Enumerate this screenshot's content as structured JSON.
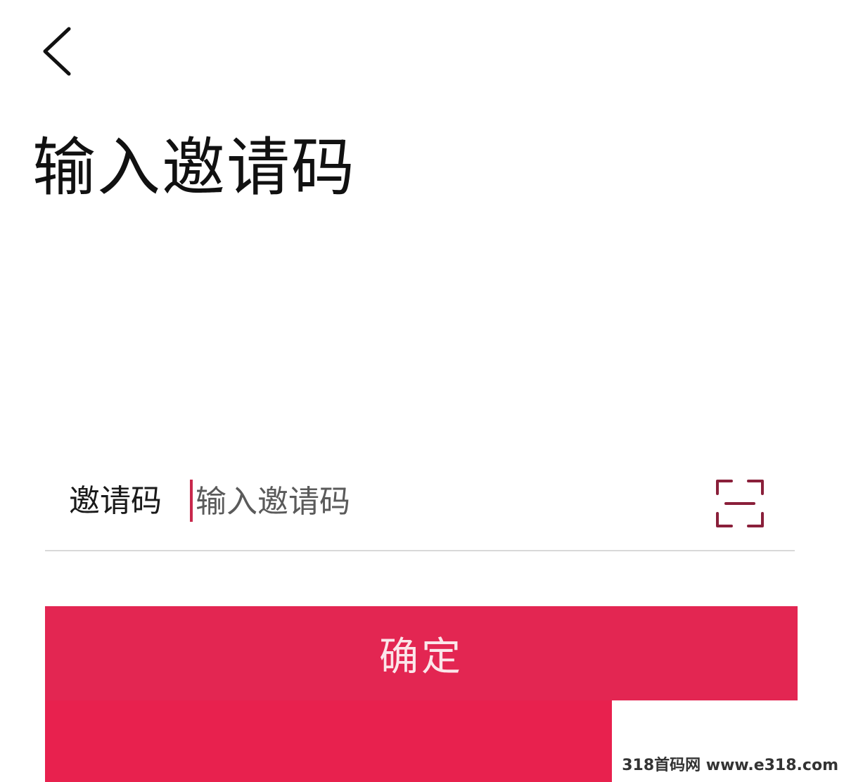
{
  "header": {
    "back_icon": "chevron-left-icon",
    "title": "输入邀请码"
  },
  "invite_field": {
    "label": "邀请码",
    "value": "",
    "placeholder": "输入邀请码",
    "scan_icon": "scan-icon"
  },
  "actions": {
    "confirm_label": "确定"
  },
  "watermark": {
    "text": "318首码网 www.e318.com"
  },
  "colors": {
    "accent": "#e32652",
    "caret": "#c8284c",
    "scan_icon": "#8a1f3a",
    "divider": "#d9d9d9"
  }
}
